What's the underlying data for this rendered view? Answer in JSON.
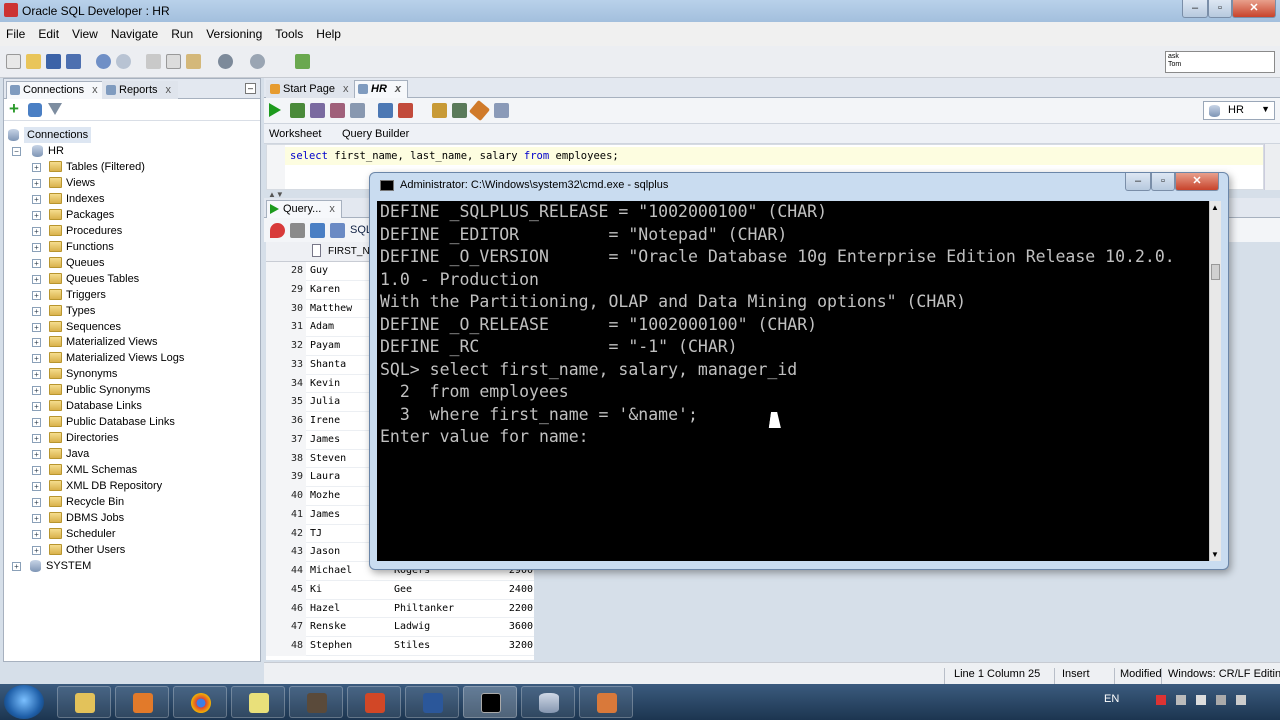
{
  "window": {
    "title": "Oracle SQL Developer : HR"
  },
  "menu": [
    "File",
    "Edit",
    "View",
    "Navigate",
    "Run",
    "Versioning",
    "Tools",
    "Help"
  ],
  "asktom": {
    "line1": "ask",
    "line2": "Tom"
  },
  "left_tabs": [
    {
      "label": "Connections"
    },
    {
      "label": "Reports"
    }
  ],
  "tree": {
    "root": "Connections",
    "hr": "HR",
    "items": [
      "Tables (Filtered)",
      "Views",
      "Indexes",
      "Packages",
      "Procedures",
      "Functions",
      "Queues",
      "Queues Tables",
      "Triggers",
      "Types",
      "Sequences",
      "Materialized Views",
      "Materialized Views Logs",
      "Synonyms",
      "Public Synonyms",
      "Database Links",
      "Public Database Links",
      "Directories",
      "Java",
      "XML Schemas",
      "XML DB Repository",
      "Recycle Bin",
      "DBMS Jobs",
      "Scheduler",
      "Other Users"
    ],
    "system": "SYSTEM"
  },
  "editor_tabs": [
    {
      "label": "Start Page"
    },
    {
      "label": "HR"
    }
  ],
  "connection_select": "HR",
  "sub_tabs": {
    "worksheet": "Worksheet",
    "query_builder": "Query Builder"
  },
  "sql": {
    "kw1": "select",
    "p1": " first_name, last_name, salary ",
    "kw2": "from",
    "p2": " employees;"
  },
  "results_tab": "Query...",
  "results_toolbar_text": "SQL",
  "grid_header": {
    "first_name": "FIRST_NAME"
  },
  "grid_rows": [
    {
      "n": "28",
      "f": "Guy",
      "l": "",
      "s": ""
    },
    {
      "n": "29",
      "f": "Karen",
      "l": "",
      "s": ""
    },
    {
      "n": "30",
      "f": "Matthew",
      "l": "",
      "s": ""
    },
    {
      "n": "31",
      "f": "Adam",
      "l": "",
      "s": ""
    },
    {
      "n": "32",
      "f": "Payam",
      "l": "",
      "s": ""
    },
    {
      "n": "33",
      "f": "Shanta",
      "l": "",
      "s": ""
    },
    {
      "n": "34",
      "f": "Kevin",
      "l": "",
      "s": ""
    },
    {
      "n": "35",
      "f": "Julia",
      "l": "",
      "s": ""
    },
    {
      "n": "36",
      "f": "Irene",
      "l": "",
      "s": ""
    },
    {
      "n": "37",
      "f": "James",
      "l": "",
      "s": ""
    },
    {
      "n": "38",
      "f": "Steven",
      "l": "",
      "s": ""
    },
    {
      "n": "39",
      "f": "Laura",
      "l": "",
      "s": ""
    },
    {
      "n": "40",
      "f": "Mozhe",
      "l": "",
      "s": ""
    },
    {
      "n": "41",
      "f": "James",
      "l": "",
      "s": ""
    },
    {
      "n": "42",
      "f": "TJ",
      "l": "",
      "s": ""
    },
    {
      "n": "43",
      "f": "Jason",
      "l": "",
      "s": ""
    },
    {
      "n": "44",
      "f": "Michael",
      "l": "Rogers",
      "s": "2900"
    },
    {
      "n": "45",
      "f": "Ki",
      "l": "Gee",
      "s": "2400"
    },
    {
      "n": "46",
      "f": "Hazel",
      "l": "Philtanker",
      "s": "2200"
    },
    {
      "n": "47",
      "f": "Renske",
      "l": "Ladwig",
      "s": "3600"
    },
    {
      "n": "48",
      "f": "Stephen",
      "l": "Stiles",
      "s": "3200"
    }
  ],
  "status": {
    "position": "Line 1 Column 25",
    "mode": "Insert",
    "modified": "Modified",
    "eol": "Windows: CR/LF Editing"
  },
  "cmd": {
    "title": "Administrator: C:\\Windows\\system32\\cmd.exe - sqlplus",
    "lines": [
      "DEFINE _SQLPLUS_RELEASE = \"1002000100\" (CHAR)",
      "DEFINE _EDITOR         = \"Notepad\" (CHAR)",
      "DEFINE _O_VERSION      = \"Oracle Database 10g Enterprise Edition Release 10.2.0.",
      "1.0 - Production",
      "With the Partitioning, OLAP and Data Mining options\" (CHAR)",
      "DEFINE _O_RELEASE      = \"1002000100\" (CHAR)",
      "DEFINE _RC             = \"-1\" (CHAR)",
      "SQL> select first_name, salary, manager_id",
      "  2  from employees",
      "  3  where first_name = '&name';",
      "Enter value for name:"
    ]
  },
  "tray": {
    "lang": "EN"
  },
  "colors": {
    "keyword": "#0000cc",
    "console_bg": "#000000",
    "console_fg": "#c0c0c0"
  }
}
